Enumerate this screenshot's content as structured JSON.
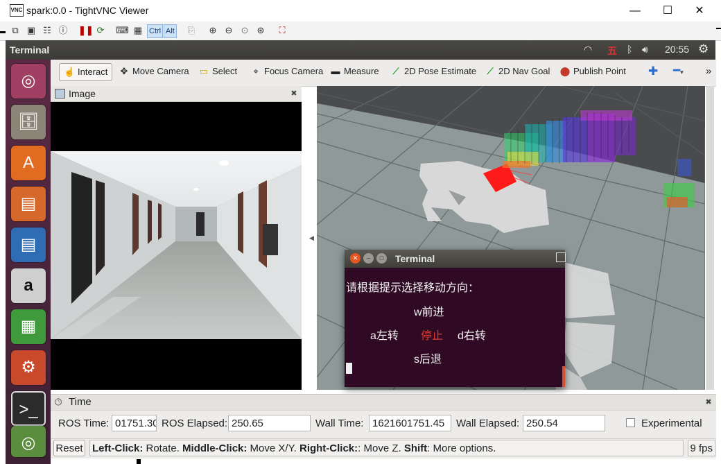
{
  "window": {
    "title": "spark:0.0 - TightVNC Viewer",
    "app_icon_label": "VNC",
    "minimize": "—",
    "maximize": "☐",
    "close": "✕"
  },
  "vnc_toolbar": {
    "ctrl_label": "Ctrl",
    "alt_label": "Alt"
  },
  "panel": {
    "title": "Terminal",
    "clock": "20:55"
  },
  "rviz_tools": {
    "interact": "Interact",
    "move_camera": "Move Camera",
    "select": "Select",
    "focus_camera": "Focus Camera",
    "measure": "Measure",
    "pose_estimate": "2D Pose Estimate",
    "nav_goal": "2D Nav Goal",
    "publish_point": "Publish Point"
  },
  "image_panel": {
    "title": "Image"
  },
  "terminal": {
    "title": "Terminal",
    "prompt": "请根据提示选择移动方向：",
    "forward": "w前进",
    "left": "a左转",
    "stop": "停止",
    "right": "d右转",
    "back": "s后退"
  },
  "time_panel": {
    "title": "Time",
    "ros_time_label": "ROS Time:",
    "ros_time": "01751.30",
    "ros_elapsed_label": "ROS Elapsed:",
    "ros_elapsed": "250.65",
    "wall_time_label": "Wall Time:",
    "wall_time": "1621601751.45",
    "wall_elapsed_label": "Wall Elapsed:",
    "wall_elapsed": "250.54",
    "experimental_label": "Experimental",
    "experimental_checked": false
  },
  "status": {
    "reset_label": "Reset",
    "left_click_key": "Left-Click:",
    "left_click_desc": " Rotate. ",
    "middle_click_key": "Middle-Click:",
    "middle_click_desc": " Move X/Y. ",
    "right_click_key": "Right-Click:",
    "right_click_desc": ": Move Z. ",
    "shift_key": "Shift",
    "shift_desc": ": More options.",
    "fps": "9 fps"
  },
  "colors": {
    "panel_bg": "#3c3b37",
    "launcher_bg": "#4a2339",
    "terminal_bg": "#300a24",
    "grid_line": "#6a6b6d",
    "stop_red": "#e23a2a"
  }
}
